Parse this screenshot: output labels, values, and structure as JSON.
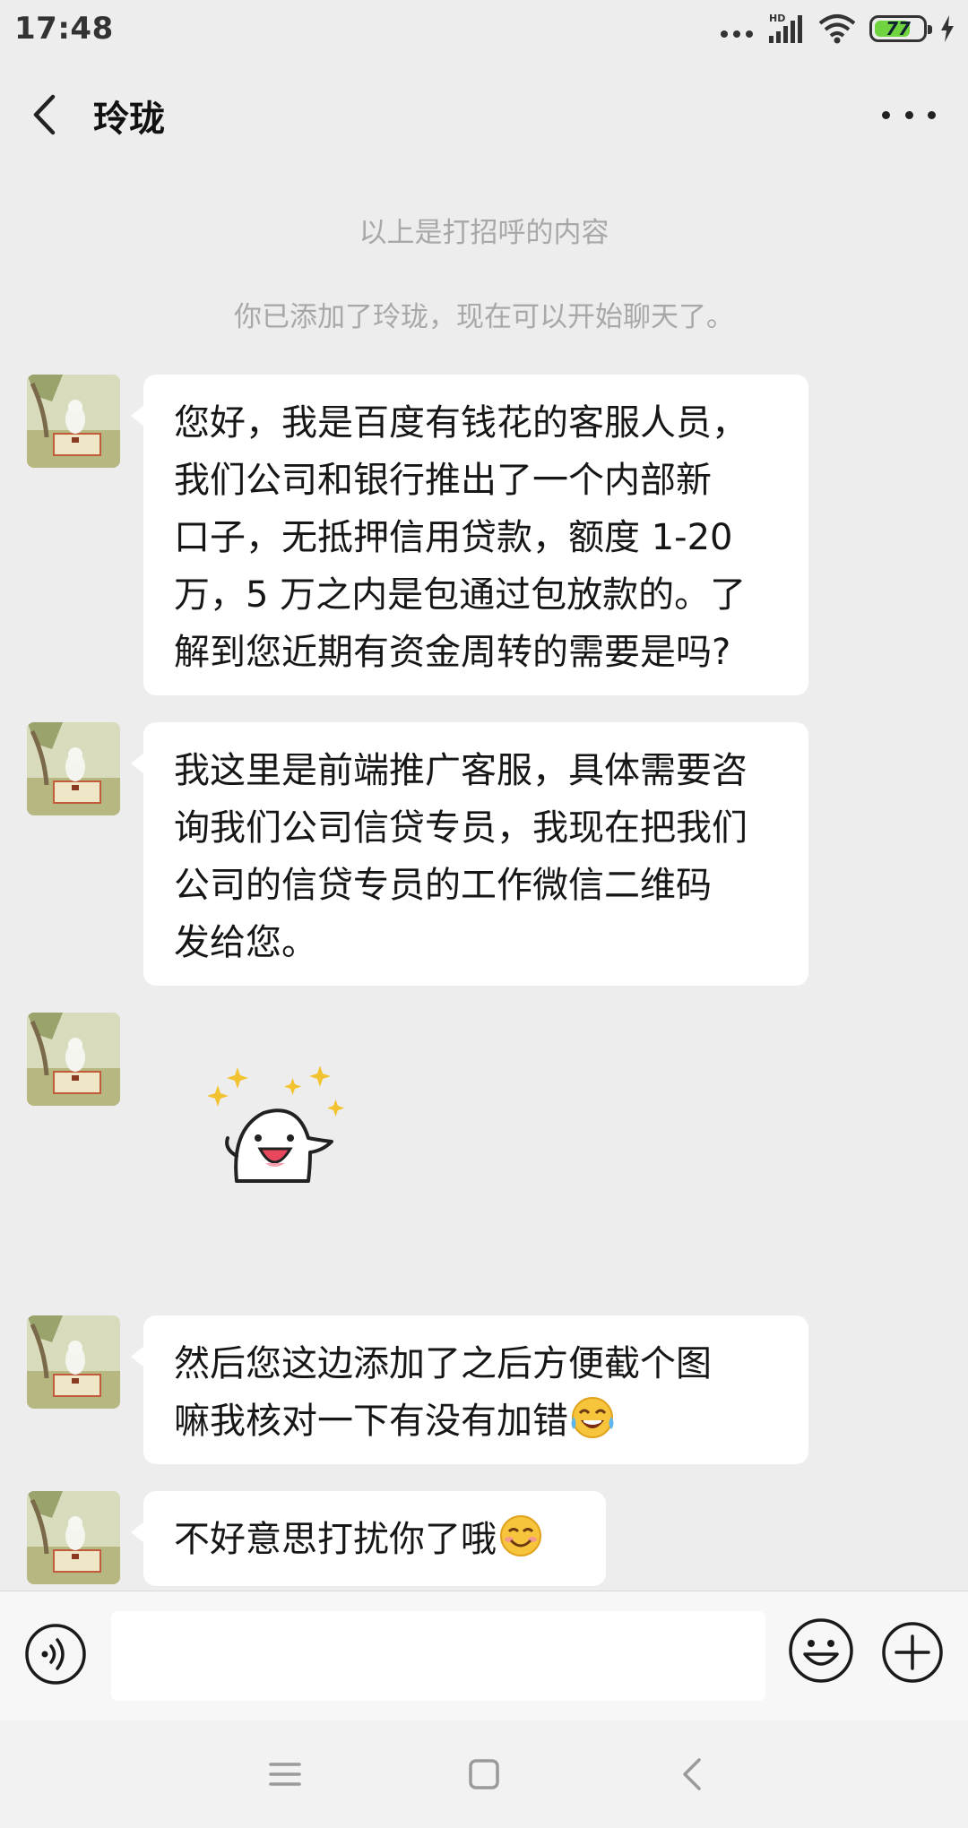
{
  "status_bar": {
    "time": "17:48",
    "network_label": "HD",
    "battery_level": "77",
    "battery_percent": 77
  },
  "header": {
    "title": "玲珑"
  },
  "chat": {
    "system_messages": [
      "以上是打招呼的内容",
      "你已添加了玲珑，现在可以开始聊天了。"
    ],
    "messages": [
      {
        "text": "您好，我是百度有钱花的客服人员，\n我们公司和银行推出了一个内部新\n口子，无抵押信用贷款，额度 1-20\n万，5 万之内是包通过包放款的。了\n解到您近期有资金周转的需要是吗?"
      },
      {
        "text": "我这里是前端推广客服，具体需要咨\n询我们公司信贷专员，我现在把我们\n公司的信贷专员的工作微信二维码\n发给您。"
      },
      {
        "sticker": "happy-ghost-sticker"
      },
      {
        "text": "然后您这边添加了之后方便截个图\n嘛我核对一下有没有加错",
        "emoji": "tears-of-joy-emoji"
      },
      {
        "text": "不好意思打扰你了哦",
        "emoji": "smiling-face-emoji"
      }
    ]
  },
  "input_bar": {
    "placeholder": ""
  },
  "colors": {
    "background": "#ededed",
    "bubble": "#ffffff",
    "system_text": "#a8a8a8",
    "battery_fill": "#6fd43f"
  }
}
